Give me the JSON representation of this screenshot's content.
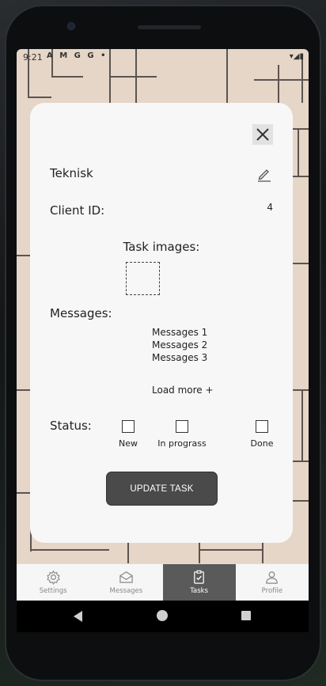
{
  "status_bar": {
    "time": "9:21",
    "icons": [
      "A",
      "M",
      "G",
      "G",
      "•"
    ],
    "right": "▾◢▮"
  },
  "modal": {
    "title": "Teknisk",
    "client_label": "Client ID:",
    "client_value": "4",
    "images_label": "Task images:",
    "messages_label": "Messages:",
    "messages": [
      "Messages 1",
      "Messages 2",
      "Messages 3"
    ],
    "load_more": "Load more +",
    "status_label": "Status:",
    "status_options": [
      "New",
      "In prograss",
      "Done"
    ],
    "update_button": "UPDATE TASK"
  },
  "bottom_nav": {
    "items": [
      {
        "label": "Settings",
        "icon": "gear-icon"
      },
      {
        "label": "Messages",
        "icon": "envelope-icon"
      },
      {
        "label": "Tasks",
        "icon": "clipboard-check-icon",
        "active": true
      },
      {
        "label": "Profile",
        "icon": "person-icon"
      }
    ]
  }
}
